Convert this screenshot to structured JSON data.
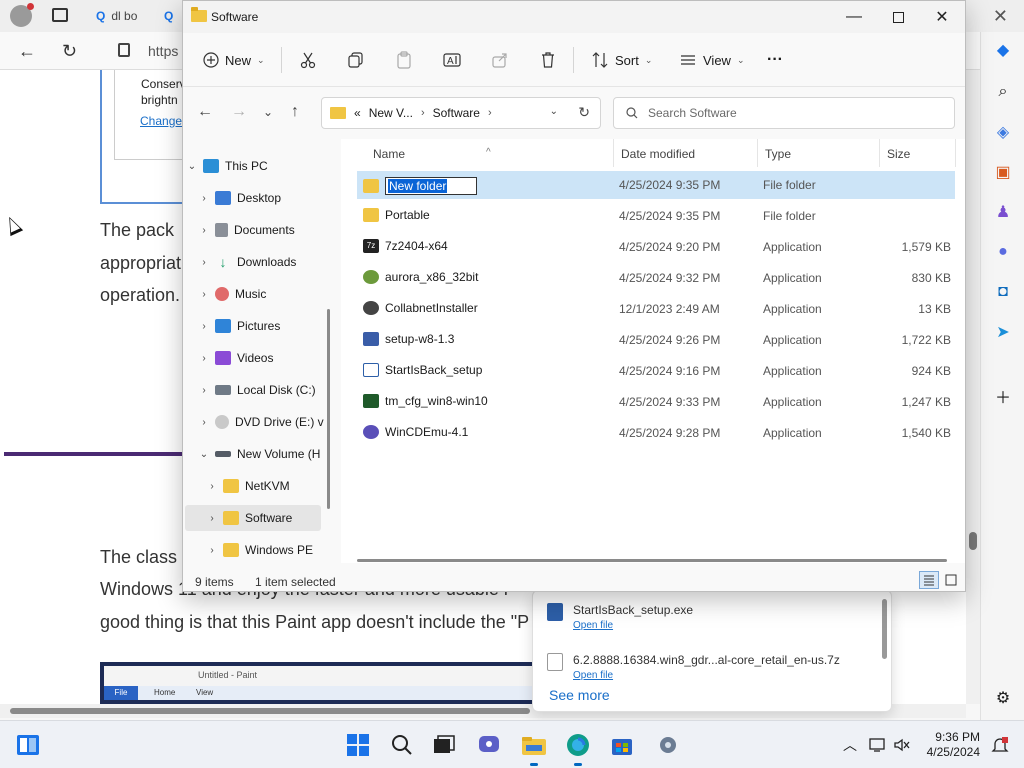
{
  "browser": {
    "tab_search_label": "dl bo",
    "url_prefix": "https",
    "page_box_text_1": "Conserv",
    "page_box_text_2": "brightn",
    "page_box_link": "Change",
    "para1_line1": "The pack",
    "para1_line2": "appropriat",
    "para1_line3": "operation.",
    "para2_line1": "The class",
    "para2_line2": "Windows 11 and enjoy the faster and more usable i",
    "para2_line3": "good thing is that this Paint app doesn't include the \"P",
    "shot_title": "Untitled - Paint",
    "shot_tab_file": "File",
    "shot_tab_home": "Home",
    "shot_tab_view": "View"
  },
  "downloads": {
    "item1_name": "StartIsBack_setup.exe",
    "item1_action": "Open file",
    "item2_name": "6.2.8888.16384.win8_gdr...al-core_retail_en-us.7z",
    "item2_action": "Open file",
    "see_more": "See more"
  },
  "explorer": {
    "title": "Software",
    "toolbar": {
      "new_label": "New",
      "sort_label": "Sort",
      "view_label": "View",
      "more_label": "···"
    },
    "breadcrumb": {
      "overflow": "«",
      "part1": "New V...",
      "part2": "Software"
    },
    "search_placeholder": "Search Software",
    "nav": [
      {
        "label": "This PC",
        "exp": "⌄",
        "icon_color": "#2b8fd6"
      },
      {
        "label": "Desktop",
        "exp": "›",
        "icon_color": "#3a7bd5"
      },
      {
        "label": "Documents",
        "exp": "›",
        "icon_color": "#8a8f98"
      },
      {
        "label": "Downloads",
        "exp": "›",
        "icon_color": "#1f9e6a"
      },
      {
        "label": "Music",
        "exp": "›",
        "icon_color": "#e06a6a"
      },
      {
        "label": "Pictures",
        "exp": "›",
        "icon_color": "#2f84d8"
      },
      {
        "label": "Videos",
        "exp": "›",
        "icon_color": "#8b4bd6"
      },
      {
        "label": "Local Disk (C:)",
        "exp": "›",
        "icon_color": "#6f7a86"
      },
      {
        "label": "DVD Drive (E:) v",
        "exp": "›",
        "icon_color": "#b5b5b5"
      },
      {
        "label": "New Volume (H",
        "exp": "⌄",
        "icon_color": "#555c66"
      },
      {
        "label": "NetKVM",
        "exp": "›",
        "icon_color": "#f0c543"
      },
      {
        "label": "Software",
        "exp": "›",
        "icon_color": "#f0c543"
      },
      {
        "label": "Windows PE",
        "exp": "›",
        "icon_color": "#f0c543"
      }
    ],
    "columns": {
      "name": "Name",
      "date": "Date modified",
      "type": "Type",
      "size": "Size"
    },
    "rows": [
      {
        "name": "New folder",
        "date": "4/25/2024 9:35 PM",
        "type": "File folder",
        "size": "",
        "icon_color": "#f0c543"
      },
      {
        "name": "Portable",
        "date": "4/25/2024 9:35 PM",
        "type": "File folder",
        "size": "",
        "icon_color": "#f0c543"
      },
      {
        "name": "7z2404-x64",
        "date": "4/25/2024 9:20 PM",
        "type": "Application",
        "size": "1,579 KB",
        "icon_color": "#222222"
      },
      {
        "name": "aurora_x86_32bit",
        "date": "4/25/2024 9:32 PM",
        "type": "Application",
        "size": "830 KB",
        "icon_color": "#6c9a3b"
      },
      {
        "name": "CollabnetInstaller",
        "date": "12/1/2023 2:49 AM",
        "type": "Application",
        "size": "13 KB",
        "icon_color": "#444444"
      },
      {
        "name": "setup-w8-1.3",
        "date": "4/25/2024 9:26 PM",
        "type": "Application",
        "size": "1,722 KB",
        "icon_color": "#3a5da8"
      },
      {
        "name": "StartIsBack_setup",
        "date": "4/25/2024 9:16 PM",
        "type": "Application",
        "size": "924 KB",
        "icon_color": "#2d5fa8"
      },
      {
        "name": "tm_cfg_win8-win10",
        "date": "4/25/2024 9:33 PM",
        "type": "Application",
        "size": "1,247 KB",
        "icon_color": "#1f5a2a"
      },
      {
        "name": "WinCDEmu-4.1",
        "date": "4/25/2024 9:28 PM",
        "type": "Application",
        "size": "1,540 KB",
        "icon_color": "#5a4fb8"
      }
    ],
    "status": {
      "items": "9 items",
      "selected": "1 item selected"
    }
  },
  "taskbar": {
    "time": "9:36 PM",
    "date": "4/25/2024"
  },
  "colors": {
    "accent": "#0067c0",
    "selection": "#cce4f7",
    "folder": "#f0c543"
  }
}
